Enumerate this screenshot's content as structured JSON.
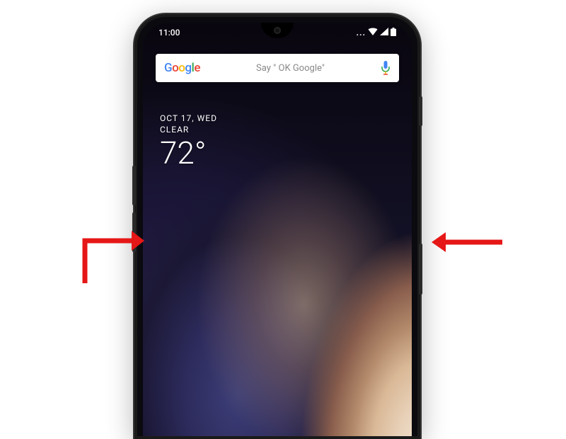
{
  "status_bar": {
    "time": "11:00",
    "dots": "..."
  },
  "search": {
    "placeholder": "Say \" OK Google\""
  },
  "weather": {
    "date": "OCT 17, WED",
    "condition": "CLEAR",
    "temperature": "72°"
  }
}
